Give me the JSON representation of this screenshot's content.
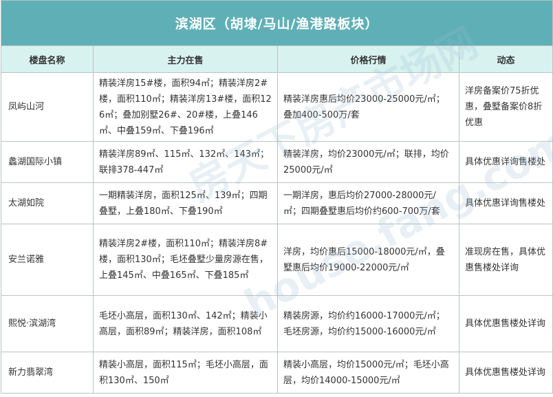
{
  "title": "滨湖区（胡埭/马山/渔港路板块）",
  "columns": [
    "楼盘名称",
    "主力在售",
    "价格行情",
    "动态"
  ],
  "rows": [
    {
      "name": "凤屿山河",
      "selling": "精装洋房15#楼，面积94㎡；精装洋房2#楼，面积110㎡；精装洋房13#楼，面积126㎡；叠加别墅26#、20#楼，上叠146㎡、中叠159㎡、下叠196㎡",
      "price": "精装洋房惠后均价23000-25000元/㎡；叠加400-500万/套",
      "news": "洋房备案价75折优惠，叠墅备案价8折优惠"
    },
    {
      "name": "蠡湖国际小镇",
      "selling": "精装洋房89㎡、115㎡、132㎡、143㎡；联排378-447㎡",
      "price": "精装洋房，均价23000元/㎡；联排，均价25000元/㎡",
      "news": "具体优惠详询售楼处"
    },
    {
      "name": "太湖如院",
      "selling": "一期精装洋房，面积125㎡、139㎡；四期叠墅，上叠180㎡、下叠190㎡",
      "price": "一期洋房，惠后均价27000-28000元/㎡；四期叠墅惠后均价约600-700万/套",
      "news": "具体优惠详询售楼处"
    },
    {
      "name": "安兰诺雅",
      "selling": "精装洋房2#楼，面积110㎡；精装洋房8#楼，面积130㎡；毛坯叠墅少量房源在售，上叠145㎡、中叠165㎡、下叠185㎡",
      "price": "洋房，均价惠后15000-18000元/㎡，叠墅惠后均价19000-22000元/㎡",
      "news": "准现房在售，具体优惠售楼处详询"
    },
    {
      "name": "熙悦·滨湖湾",
      "selling": "毛坯小高层，面积130㎡、142㎡；精装小高层，面积89㎡；精装洋房，面积108㎡",
      "price": "精装房源，均价约16000-17000元/㎡；毛坯房源，均价约15000-16000元/㎡",
      "news": "具体优惠售楼处详询"
    },
    {
      "name": "新力翡翠湾",
      "selling": "精装小高层，面积115㎡；毛坯小高层，面积130㎡、150㎡",
      "price": "精装小高层，均价15000元/㎡；毛坯小高层，均价14000-15000元/㎡",
      "news": "具体优惠售楼处详询"
    }
  ],
  "colors": {
    "title_bg": "#5fb0b6",
    "header_bg": "#d8f2f0",
    "border": "#b9c3c2",
    "text": "#333333"
  },
  "watermarks": [
    "房天下房产市场网",
    "house.fang.com"
  ]
}
